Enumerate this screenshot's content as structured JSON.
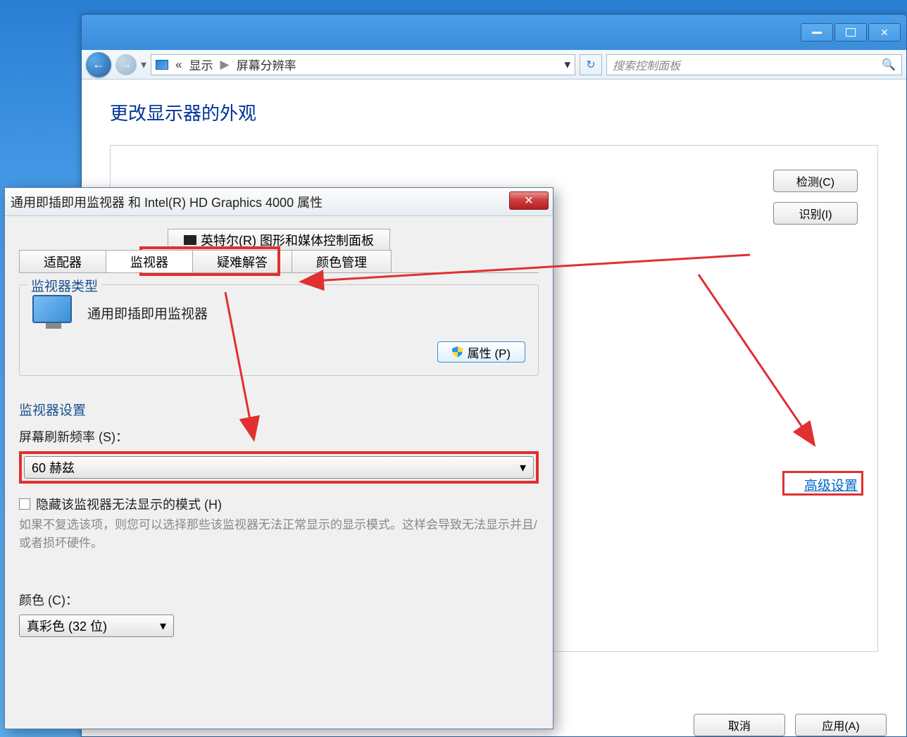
{
  "mainWindow": {
    "breadcrumb": {
      "chevron": "«",
      "level1": "显示",
      "sep": "▶",
      "level2": "屏幕分辨率"
    },
    "searchPlaceholder": "搜索控制面板",
    "pageTitle": "更改显示器的外观",
    "buttons": {
      "detect": "检测(C)",
      "identify": "识别(I)",
      "cancel": "取消",
      "apply": "应用(A)"
    },
    "advancedLink": "高级设置"
  },
  "propsDialog": {
    "title": "通用即插即用监视器 和 Intel(R) HD Graphics 4000 属性",
    "intelTab": "英特尔(R) 图形和媒体控制面板",
    "tabs": {
      "adapter": "适配器",
      "monitor": "监视器",
      "troubleshoot": "疑难解答",
      "colorMgmt": "颜色管理"
    },
    "monitorType": {
      "groupTitle": "监视器类型",
      "name": "通用即插即用监视器",
      "propsBtn": "属性 (P)"
    },
    "monitorSettings": {
      "groupTitle": "监视器设置",
      "refreshLabel": "屏幕刷新频率 (S)：",
      "refreshValue": "60 赫兹",
      "hideModesCheckbox": "隐藏该监视器无法显示的模式 (H)",
      "hideModesHint": "如果不复选该项，则您可以选择那些该监视器无法正常显示的显示模式。这样会导致无法显示并且/或者损坏硬件。",
      "colorLabel": "颜色 (C)：",
      "colorValue": "真彩色 (32 位)"
    }
  }
}
